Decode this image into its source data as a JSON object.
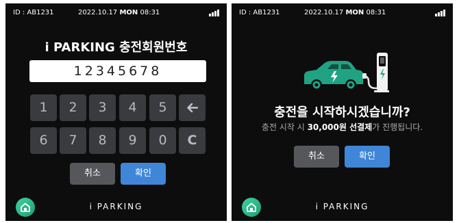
{
  "status": {
    "user_id": "ID : AB1231",
    "date": "2022.10.17",
    "weekday": "MON",
    "time": "08:31",
    "signal_icon": "signal-bars-icon"
  },
  "left": {
    "title": "i PARKING 충전회원번호",
    "pin_value": "12345678",
    "keys": [
      "1",
      "2",
      "3",
      "4",
      "5",
      "←",
      "6",
      "7",
      "8",
      "9",
      "0",
      "C"
    ],
    "cancel_label": "취소",
    "confirm_label": "확인"
  },
  "right": {
    "question": "충전을 시작하시겠습니까?",
    "note_prefix": "충전 시작 시 ",
    "note_amount": "30,000원 선결제",
    "note_suffix": "가 진행됩니다.",
    "cancel_label": "취소",
    "confirm_label": "확인",
    "illustration_icon": "ev-car-charger-icon"
  },
  "footer": {
    "brand": "i PARKING",
    "home_icon": "home-icon"
  },
  "colors": {
    "screen_bg": "#0d0d0d",
    "key_bg": "#3a3b3e",
    "accent_blue": "#3f86d8",
    "button_gray": "#55575a",
    "ev_green": "#1fa383"
  }
}
